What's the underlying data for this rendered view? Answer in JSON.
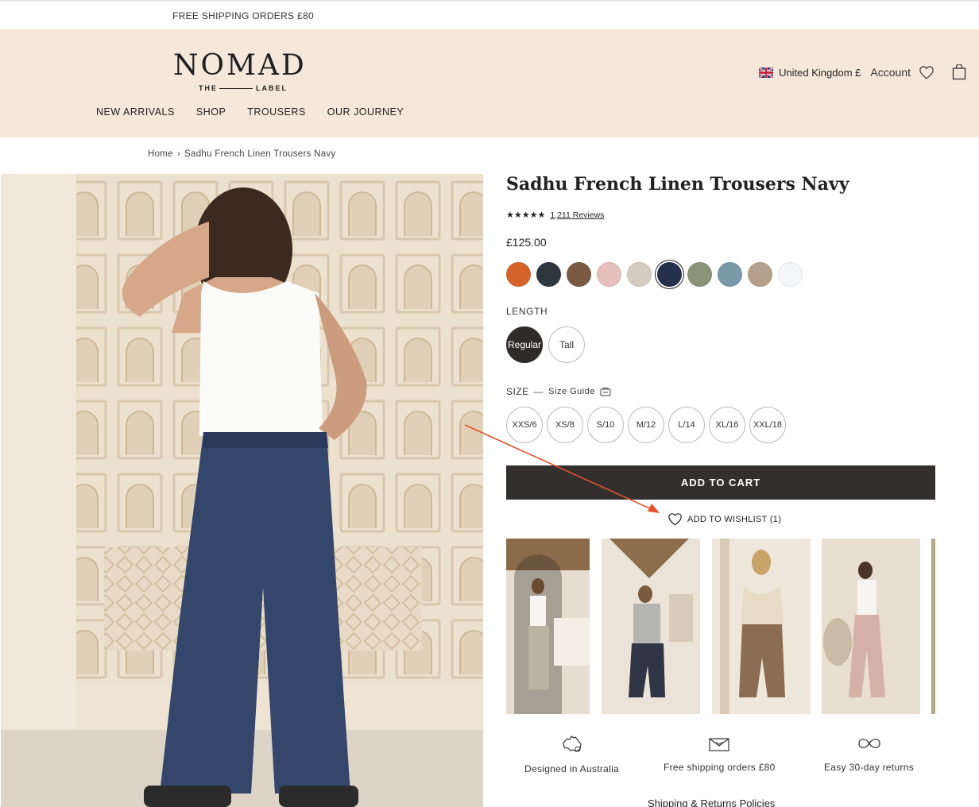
{
  "announcement": "FREE SHIPPING ORDERS £80",
  "brand": {
    "name": "NOMAD",
    "sub_left": "THE",
    "sub_right": "LABEL"
  },
  "nav": [
    "NEW ARRIVALS",
    "SHOP",
    "TROUSERS",
    "OUR JOURNEY"
  ],
  "utils": {
    "country": "United Kingdom £",
    "account": "Account"
  },
  "breadcrumb": {
    "home": "Home",
    "current": "Sadhu French Linen Trousers Navy"
  },
  "product": {
    "title": "Sadhu French Linen Trousers Navy",
    "stars": "★★★★★",
    "reviews": "1,211 Reviews",
    "price": "£125.00",
    "swatches": [
      {
        "name": "rust",
        "color": "#d6642a"
      },
      {
        "name": "charcoal",
        "color": "#2e3640"
      },
      {
        "name": "brown",
        "color": "#7b5a44"
      },
      {
        "name": "pink",
        "color": "#e7bfbd"
      },
      {
        "name": "stone",
        "color": "#d6cbc0"
      },
      {
        "name": "navy",
        "color": "#25304d",
        "selected": true
      },
      {
        "name": "sage",
        "color": "#8a9479"
      },
      {
        "name": "blue",
        "color": "#7a9aaa"
      },
      {
        "name": "taupe",
        "color": "#b6a08b"
      },
      {
        "name": "white",
        "color": "#f4f6f8"
      }
    ],
    "length_label": "LENGTH",
    "lengths": [
      {
        "label": "Regular",
        "active": true
      },
      {
        "label": "Tall",
        "active": false
      }
    ],
    "size_label": "SIZE",
    "size_dash": "—",
    "size_guide": "Size Guide",
    "sizes": [
      "XXS/6",
      "XS/8",
      "S/10",
      "M/12",
      "L/14",
      "XL/16",
      "XXL/18"
    ],
    "add_to_cart": "ADD TO CART",
    "wishlist": "ADD TO WISHLIST (1)"
  },
  "features": [
    {
      "icon": "australia-icon",
      "label": "Designed in Australia"
    },
    {
      "icon": "envelope-icon",
      "label": "Free shipping orders £80"
    },
    {
      "icon": "infinity-icon",
      "label": "Easy 30-day returns"
    }
  ],
  "policies": "Shipping & Returns Policies",
  "colors": {
    "header_bg": "#f5e8da",
    "button": "#332f2f",
    "annotation_arrow": "#e5512b"
  }
}
